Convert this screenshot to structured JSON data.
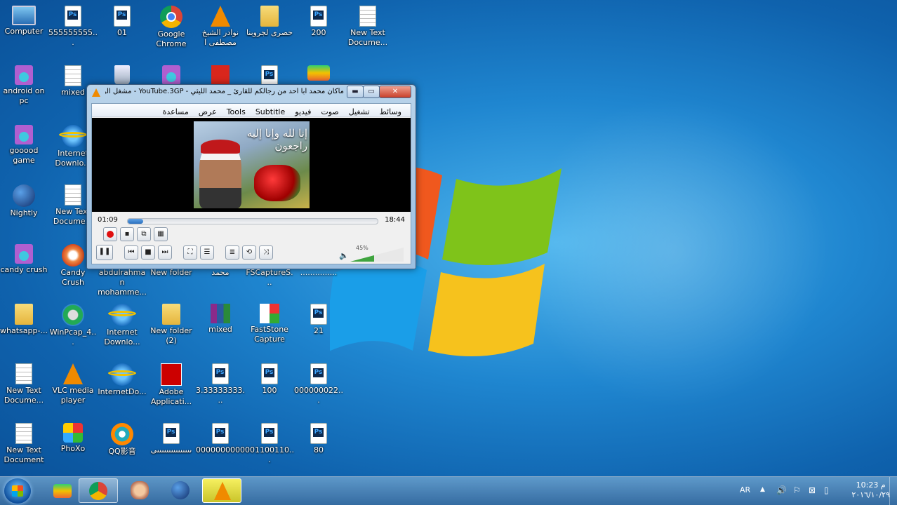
{
  "desktop": {
    "icons": [
      {
        "label": "Computer",
        "icon": "computer-icon"
      },
      {
        "label": "555555555...",
        "icon": "psd-file-icon"
      },
      {
        "label": "01",
        "icon": "psd-file-icon"
      },
      {
        "label": "Google Chrome",
        "icon": "chrome-icon"
      },
      {
        "label": "نوادر الشيخ مصطفى ا",
        "icon": "vlc-icon"
      },
      {
        "label": "حصرى لجروبنا",
        "icon": "folder-icon"
      },
      {
        "label": "200",
        "icon": "psd-file-icon"
      },
      {
        "label": "New Text Docume...",
        "icon": "text-file-icon"
      },
      {
        "label": "android on pc",
        "icon": "media-file-icon"
      },
      {
        "label": "mixed",
        "icon": "settings-file-icon"
      },
      {
        "label": "",
        "icon": "recycle-bin-icon"
      },
      {
        "label": "",
        "icon": "media-file-icon"
      },
      {
        "label": "",
        "icon": "pdf-icon"
      },
      {
        "label": "",
        "icon": "psd-file-icon"
      },
      {
        "label": "",
        "icon": "bluestacks-icon"
      },
      {
        "label": "gooood game",
        "icon": "media-file-icon"
      },
      {
        "label": "Internet Downlo...",
        "icon": "ie-icon"
      },
      {
        "label": "Nightly",
        "icon": "globe-icon"
      },
      {
        "label": "New Text Docume...",
        "icon": "text-file-icon"
      },
      {
        "label": "candy crush",
        "icon": "media-file-icon"
      },
      {
        "label": "Candy Crush",
        "icon": "candy-icon"
      },
      {
        "label": "abdulrahman mohamme...",
        "icon": "blank-icon"
      },
      {
        "label": "New folder",
        "icon": "blank-icon"
      },
      {
        "label": "محمد",
        "icon": "blank-icon"
      },
      {
        "label": "FSCaptureS...",
        "icon": "blank-icon"
      },
      {
        "label": "...............",
        "icon": "blank-icon"
      },
      {
        "label": "whatsapp-...",
        "icon": "folder-icon"
      },
      {
        "label": "WinPcap_4...",
        "icon": "wincap-icon"
      },
      {
        "label": "Internet Downlo...",
        "icon": "ie-icon"
      },
      {
        "label": "New folder (2)",
        "icon": "folder-icon"
      },
      {
        "label": "mixed",
        "icon": "winrar-icon"
      },
      {
        "label": "FastStone Capture",
        "icon": "faststone-icon"
      },
      {
        "label": "21",
        "icon": "psd-file-icon"
      },
      {
        "label": "New Text Docume...",
        "icon": "text-file-icon"
      },
      {
        "label": "VLC media player",
        "icon": "vlc-icon"
      },
      {
        "label": "InternetDo...",
        "icon": "ie-icon"
      },
      {
        "label": "Adobe Applicati...",
        "icon": "adobe-icon"
      },
      {
        "label": "3.33333333...",
        "icon": "psd-file-icon"
      },
      {
        "label": "100",
        "icon": "psd-file-icon"
      },
      {
        "label": "000000022...",
        "icon": "psd-file-icon"
      },
      {
        "label": "New Text Document",
        "icon": "text-file-icon"
      },
      {
        "label": "PhoXo",
        "icon": "phoxo-icon"
      },
      {
        "label": "QQ影音",
        "icon": "qq-player-icon"
      },
      {
        "label": "ىىىىىىىىىىىىىىىى",
        "icon": "psd-file-icon"
      },
      {
        "label": "0000000000",
        "icon": "psd-file-icon"
      },
      {
        "label": "001100110...",
        "icon": "psd-file-icon"
      },
      {
        "label": "80",
        "icon": "psd-file-icon"
      }
    ]
  },
  "vlc": {
    "title": "ماكان محمد أبا أحد من رجالكم للقارئ _ محمد الليثي - YouTube.3GP - مشغل الو...",
    "menu": [
      "وسائط",
      "تشغيل",
      "صوت",
      "فيديو",
      "Subtitle",
      "Tools",
      "عرض",
      "مساعدة"
    ],
    "video_caption": "إنا لله وإنا إليه راجعون",
    "time_elapsed": "01:09",
    "time_total": "18:44",
    "progress": 0.062,
    "volume_label": "45%",
    "volume": 0.45,
    "window_buttons": {
      "minimize": "▬",
      "maximize": "▭",
      "close": "✕"
    }
  },
  "taskbar": {
    "apps": [
      "bluestacks-icon",
      "chrome-icon",
      "clipper-icon",
      "globe-icon",
      "vlc-icon"
    ],
    "language": "AR",
    "tray_overflow": "▲",
    "clock_time": "10:23 م",
    "clock_date": "٢٠١٦/١٠/٢٩"
  },
  "colors": {
    "desktop_bg": "#1f86d0",
    "vlc_frame": "#b8d3ea",
    "progress_fill": "#2b6fbd",
    "volume_fill": "#3fa43f",
    "record": "#e01010"
  }
}
